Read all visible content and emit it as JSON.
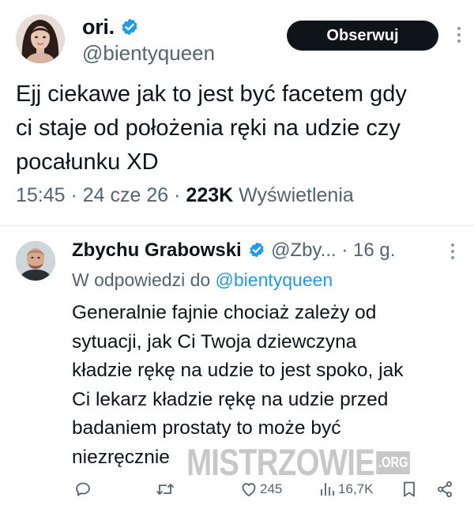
{
  "tweet": {
    "author_name": "ori.",
    "author_handle": "@bientyqueen",
    "follow_label": "Obserwuj",
    "text": "Ejj ciekawe jak to jest być facetem gdy\nci staje od położenia ręki na udzie czy\npocałunku XD",
    "time": "15:45",
    "date": "24 cze 26",
    "views_count": "223K",
    "views_label": "Wyświetlenia",
    "separator": " · ",
    "verified_icon": "verified-badge-icon",
    "more_icon": "more-vertical-icon"
  },
  "reply": {
    "author_name": "Zbychu Grabowski",
    "author_handle": "@Zby...",
    "time": "· 16 g.",
    "reply_to_prefix": "W odpowiedzi do",
    "reply_to_handle": "@bientyqueen",
    "text": "Generalnie fajnie chociaż zależy od\nsytuacji, jak Ci Twoja dziewczyna\nkładzie rękę na udzie to jest spoko, jak\nCi lekarz kładzie rękę na udzie przed\nbadaniem prostaty to może być\nniezręcznie",
    "actions": {
      "reply_icon": "reply-icon",
      "retweet_icon": "retweet-icon",
      "like_icon": "heart-icon",
      "like_count": "245",
      "views_icon": "views-chart-icon",
      "views_count": "16,7K",
      "bookmark_icon": "bookmark-icon",
      "share_icon": "share-icon"
    }
  },
  "watermark": {
    "text": "MISTRZOWIE",
    "suffix": ".ORG"
  },
  "colors": {
    "accent": "#1d9bf0",
    "text": "#0f1419",
    "muted": "#536471",
    "follow_bg": "#0f1419",
    "divider": "#e7e9ea"
  }
}
